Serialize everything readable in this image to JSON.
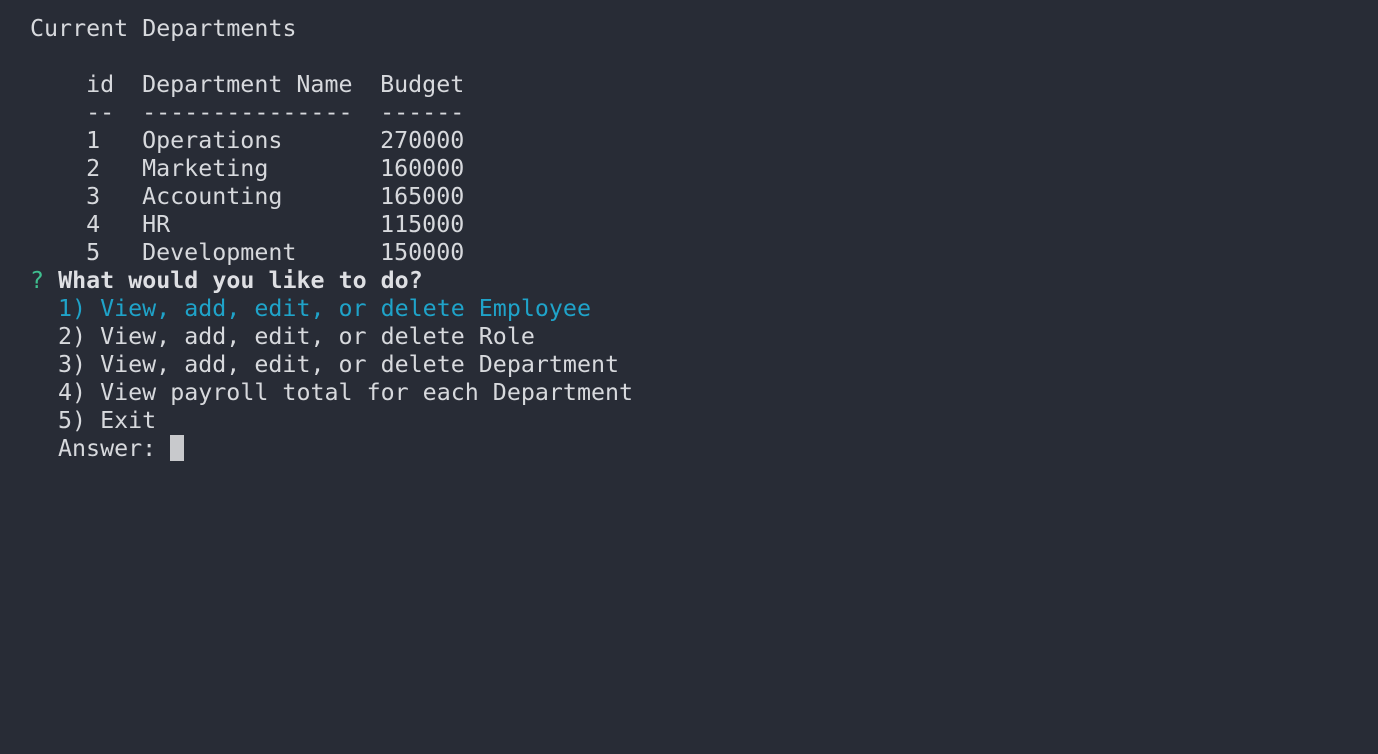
{
  "table": {
    "title": "Current Departments",
    "headers": [
      "id",
      "Department Name",
      "Budget"
    ],
    "separators": [
      "--",
      "---------------",
      "------"
    ],
    "rows": [
      {
        "id": "1",
        "name": "Operations",
        "budget": "270000"
      },
      {
        "id": "2",
        "name": "Marketing",
        "budget": "160000"
      },
      {
        "id": "3",
        "name": "Accounting",
        "budget": "165000"
      },
      {
        "id": "4",
        "name": "HR",
        "budget": "115000"
      },
      {
        "id": "5",
        "name": "Development",
        "budget": "150000"
      }
    ]
  },
  "prompt": {
    "marker": "?",
    "question": "What would you like to do?",
    "options": [
      "1) View, add, edit, or delete Employee",
      "2) View, add, edit, or delete Role",
      "3) View, add, edit, or delete Department",
      "4) View payroll total for each Department",
      "5) Exit"
    ],
    "selected_index": 0,
    "answer_label": "Answer: "
  },
  "colors": {
    "background": "#282c36",
    "text": "#d7d9dd",
    "marker": "#3fbf8f",
    "selected": "#1fa3c9"
  }
}
